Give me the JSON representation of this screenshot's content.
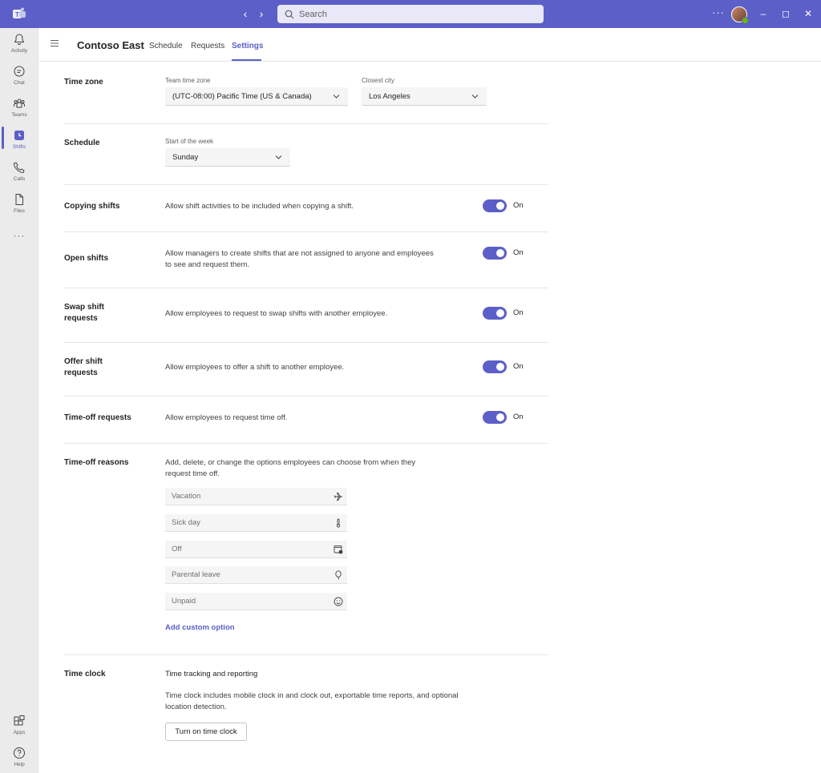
{
  "titlebar": {
    "search_placeholder": "Search",
    "more_label": "···"
  },
  "rail": {
    "items": [
      {
        "label": "Activity",
        "icon": "bell-icon"
      },
      {
        "label": "Chat",
        "icon": "chat-icon"
      },
      {
        "label": "Teams",
        "icon": "teams-icon"
      },
      {
        "label": "Shifts",
        "icon": "shifts-icon",
        "active": true
      },
      {
        "label": "Calls",
        "icon": "phone-icon"
      },
      {
        "label": "Files",
        "icon": "file-icon"
      }
    ],
    "more": "···",
    "bottom": [
      {
        "label": "Apps",
        "icon": "apps-icon"
      },
      {
        "label": "Help",
        "icon": "help-icon"
      }
    ]
  },
  "header": {
    "team_name": "Contoso East",
    "tabs": [
      "Schedule",
      "Requests",
      "Settings"
    ],
    "active_tab": "Settings"
  },
  "settings": {
    "time_zone": {
      "title": "Time zone",
      "team_tz_label": "Team time zone",
      "team_tz_value": "(UTC-08:00) Pacific Time (US & Canada)",
      "city_label": "Closest city",
      "city_value": "Los Angeles"
    },
    "schedule": {
      "title": "Schedule",
      "week_label": "Start of the week",
      "week_value": "Sunday"
    },
    "copying_shifts": {
      "title": "Copying shifts",
      "desc": "Allow shift activities to be included when copying a shift.",
      "state": "On"
    },
    "open_shifts": {
      "title": "Open shifts",
      "desc_line1": "Allow managers to create shifts that are not assigned to anyone and employees",
      "desc_line2": "to see and request them.",
      "state": "On"
    },
    "swap_shift": {
      "title_line1": "Swap shift",
      "title_line2": "requests",
      "desc": "Allow employees to request to swap shifts with another employee.",
      "state": "On"
    },
    "offer_shift": {
      "title_line1": "Offer shift",
      "title_line2": "requests",
      "desc": "Allow employees to offer a shift to another employee.",
      "state": "On"
    },
    "time_off_requests": {
      "title": "Time-off requests",
      "desc": "Allow employees to request time off.",
      "state": "On"
    },
    "time_off_reasons": {
      "title": "Time-off reasons",
      "desc_line1": "Add, delete, or change the options employees can choose from when they",
      "desc_line2": "request time off.",
      "reasons": [
        {
          "label": "Vacation",
          "icon": "airplane-icon"
        },
        {
          "label": "Sick day",
          "icon": "thermometer-icon"
        },
        {
          "label": "Off",
          "icon": "calendar-off-icon"
        },
        {
          "label": "Parental leave",
          "icon": "balloon-icon"
        },
        {
          "label": "Unpaid",
          "icon": "smiley-icon"
        }
      ],
      "add_label": "Add custom option"
    },
    "time_clock": {
      "title": "Time clock",
      "subheading": "Time tracking and reporting",
      "desc_line1": "Time clock includes mobile clock in and clock out, exportable time reports, and optional",
      "desc_line2": "location detection.",
      "button_label": "Turn on time clock"
    }
  },
  "colors": {
    "accent": "#5b5fc7",
    "titlebar": "#5b5fc7",
    "rail": "#ebebeb"
  }
}
